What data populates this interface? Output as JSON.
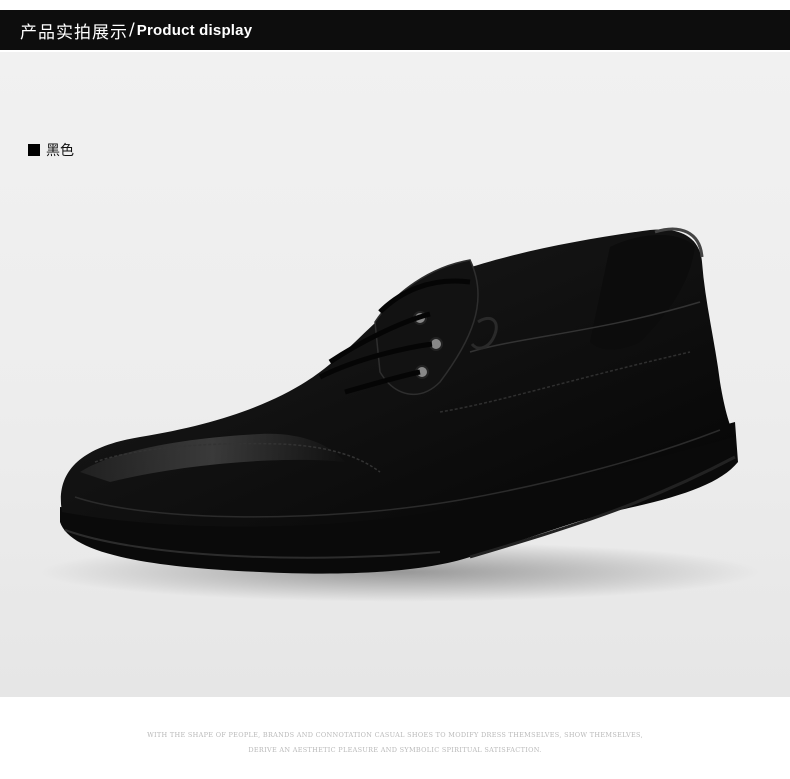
{
  "header": {
    "title_cn": "产品实拍展示",
    "separator": "/",
    "title_en": "Product display"
  },
  "color_option": {
    "label": "黑色",
    "swatch_color": "#000000"
  },
  "footer": {
    "line1": "WITH THE SHAPE OF PEOPLE, BRANDS AND CONNOTATION CASUAL SHOES TO MODIFY DRESS THEMSELVES, SHOW THEMSELVES,",
    "line2": "DERIVE AN AESTHETIC PLEASURE AND SYMBOLIC SPIRITUAL SATISFACTION."
  },
  "colors": {
    "header_bg": "#0d0d0d",
    "stage_bg": "#eeeeee",
    "footer_text": "#b9b9b9"
  }
}
